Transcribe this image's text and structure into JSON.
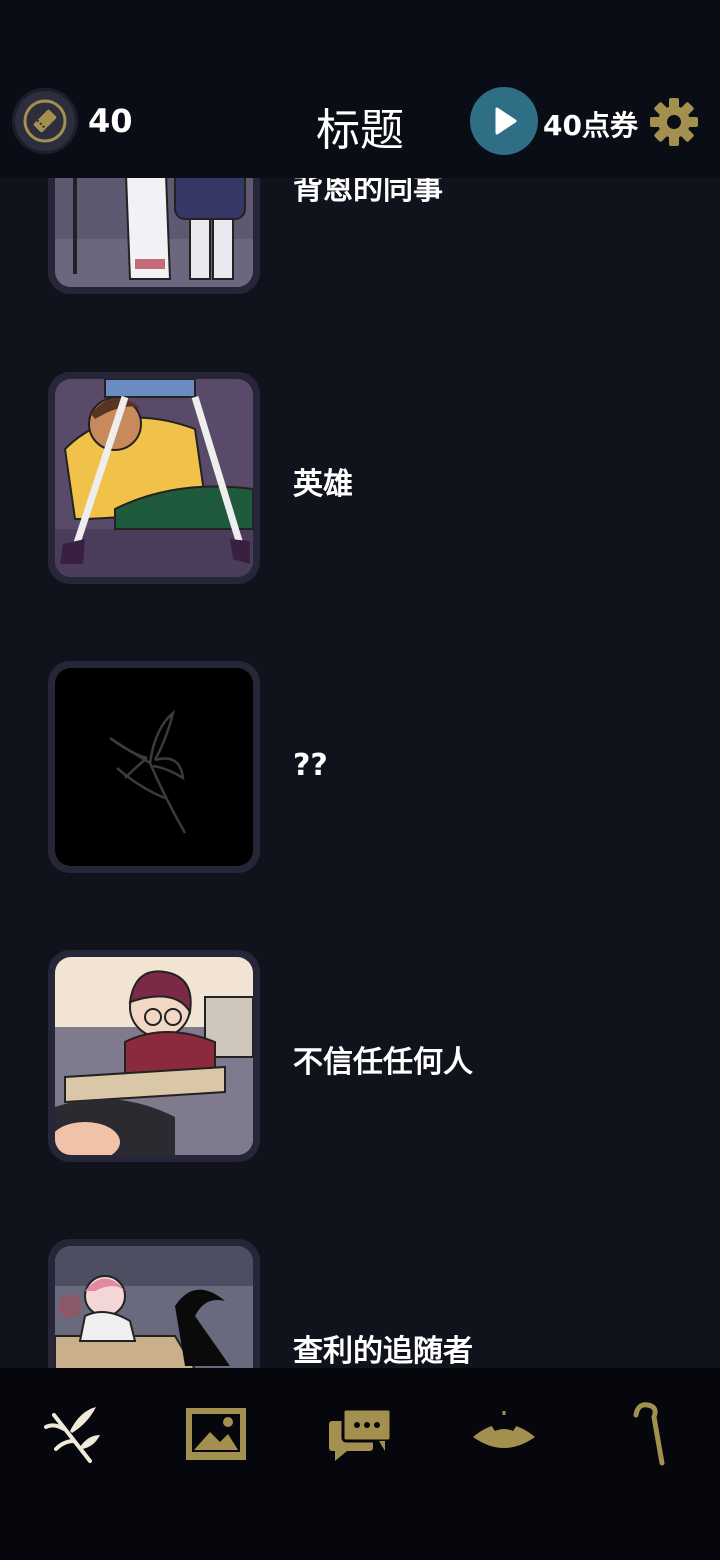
{
  "header": {
    "ticket_count": "40",
    "title": "标题",
    "coupon_label": "40点券"
  },
  "icons": {
    "ticket": "ticket-icon",
    "play": "play-icon",
    "settings": "gear-icon"
  },
  "stories": [
    {
      "title": "背恩的同事",
      "thumbnail": "comic-alley-scene"
    },
    {
      "title": "英雄",
      "thumbnail": "comic-kneeling-man"
    },
    {
      "title": "??",
      "thumbnail": "locked-flower-silhouette"
    },
    {
      "title": "不信任任何人",
      "thumbnail": "comic-classroom-desk"
    },
    {
      "title": "查利的追随者",
      "thumbnail": "comic-shadow-figure"
    }
  ],
  "nav": {
    "items": [
      "sprig-icon",
      "image-icon",
      "chat-icon",
      "hat-icon",
      "cane-icon"
    ]
  },
  "colors": {
    "background": "#11131c",
    "header": "#0a0d16",
    "accent_gold": "#a38f4e",
    "play_blue": "#2f6f86"
  }
}
